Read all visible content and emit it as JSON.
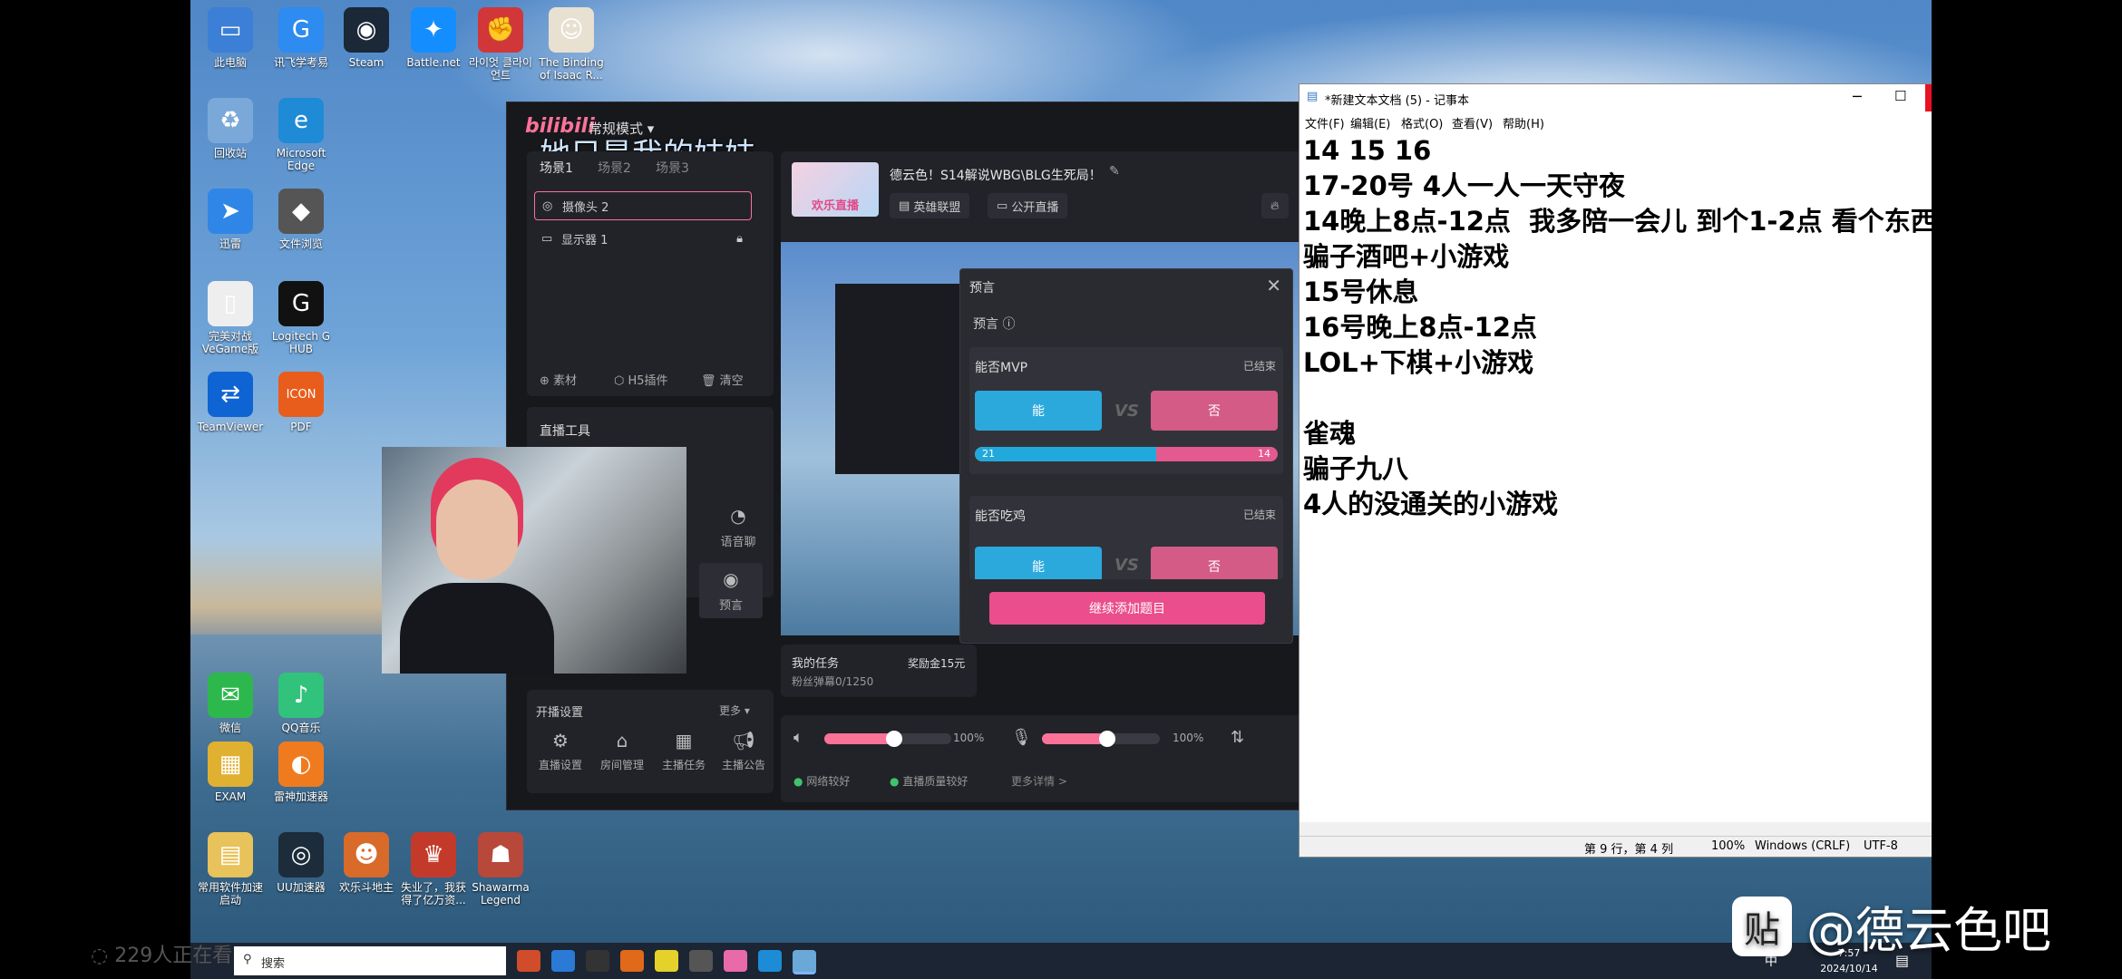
{
  "desktop_icons": [
    {
      "label": "此电脑",
      "color": "#3b7fd6",
      "glyph": "▭"
    },
    {
      "label": "讯飞学考易",
      "color": "#2e8bef",
      "glyph": "G"
    },
    {
      "label": "Steam",
      "color": "#1b2838",
      "glyph": "◉"
    },
    {
      "label": "Battle.net",
      "color": "#148eff",
      "glyph": "✦"
    },
    {
      "label": "라이엇 클라이언트",
      "color": "#d13639",
      "glyph": "✊"
    },
    {
      "label": "The Binding of Isaac R...",
      "color": "#e8e0d0",
      "glyph": "☺"
    },
    {
      "label": "回收站",
      "color": "#7aa9d9",
      "glyph": "♻"
    },
    {
      "label": "Microsoft Edge",
      "color": "#1f8ad6",
      "glyph": "e"
    },
    {
      "label": "迅雷",
      "color": "#2f86e6",
      "glyph": "➤"
    },
    {
      "label": "文件浏览",
      "color": "#555",
      "glyph": "◆"
    },
    {
      "label": "完美对战 VeGame版",
      "color": "#eee",
      "glyph": "▯"
    },
    {
      "label": "Logitech G HUB",
      "color": "#111",
      "glyph": "G"
    },
    {
      "label": "TeamViewer",
      "color": "#0e64d2",
      "glyph": "⇄"
    },
    {
      "label": "PDF",
      "color": "#e85d1c",
      "glyph": "ICON"
    },
    {
      "label": "微信",
      "color": "#2db84d",
      "glyph": "✉"
    },
    {
      "label": "QQ音乐",
      "color": "#31c27c",
      "glyph": "♪"
    },
    {
      "label": "EXAM",
      "color": "#e0b030",
      "glyph": "▦"
    },
    {
      "label": "雷神加速器",
      "color": "#f07b1e",
      "glyph": "◐"
    },
    {
      "label": "常用软件加速启动",
      "color": "#e8c25a",
      "glyph": "▤"
    },
    {
      "label": "UU加速器",
      "color": "#1c2c3a",
      "glyph": "◎"
    },
    {
      "label": "欢乐斗地主",
      "color": "#d86a2a",
      "glyph": "☻"
    },
    {
      "label": "失业了，我获得了亿万资...",
      "color": "#c43a2a",
      "glyph": "♛"
    },
    {
      "label": "Shawarma Legend",
      "color": "#b8483a",
      "glyph": "☗"
    }
  ],
  "app": {
    "logo": "bilibili",
    "mode": "常规模式 ▾",
    "overlay_title": "她只是我的妹妹",
    "scenes": [
      "场景1",
      "场景2",
      "场景3"
    ],
    "sources": [
      "摄像头 2",
      "显示器 1"
    ],
    "source_tools": [
      "素材",
      "H5插件",
      "清空"
    ],
    "tools_title": "直播工具",
    "tool_labels": [
      "语音聊",
      "预言"
    ],
    "settings_title": "开播设置",
    "more": "更多 ▾",
    "settings_items": [
      "直播设置",
      "房间管理",
      "主播任务",
      "主播公告"
    ],
    "stream_title": "德云色！S14解说WBG\\BLG生死局！",
    "stream_thumb_text": "欢乐直播",
    "category": "英雄联盟",
    "visibility": "公开直播",
    "task_title": "我的任务",
    "task_reward": "奖励金15元",
    "task_progress": "粉丝弹幕0/1250",
    "speaker_volume": "100%",
    "mic_volume": "100%",
    "speaker_level": 0.55,
    "mic_level": 0.55,
    "status_network": "网络较好",
    "status_quality": "直播质量较好",
    "status_more": "更多详情 >"
  },
  "prediction": {
    "dialog_title": "预言",
    "section_title": "预言 ⓘ",
    "cards": [
      {
        "question": "能否MVP",
        "status": "已结束",
        "yes": "能",
        "no": "否",
        "vs": "VS",
        "yes_count": "21",
        "no_count": "14",
        "yes_ratio": 0.6
      },
      {
        "question": "能否吃鸡",
        "status": "已结束",
        "yes": "能",
        "no": "否",
        "vs": "VS"
      }
    ],
    "add_button": "继续添加题目"
  },
  "notepad": {
    "title": "*新建文本文档 (5) - 记事本",
    "menu": [
      "文件(F)",
      "编辑(E)",
      "格式(O)",
      "查看(V)",
      "帮助(H)"
    ],
    "lines": [
      "14 15 16",
      "17-20号 4人一人一天守夜",
      "14晚上8点-12点  我多陪一会儿 到个1-2点 看个东西",
      "骗子酒吧+小游戏",
      "15号休息",
      "16号晚上8点-12点",
      "LOL+下棋+小游戏",
      "",
      "雀魂",
      "骗子九八",
      "4人的没通关的小游戏"
    ],
    "status": {
      "position": "第 9 行，第 4 列",
      "zoom": "100%",
      "line_ending": "Windows (CRLF)",
      "encoding": "UTF-8"
    }
  },
  "taskbar": {
    "search_placeholder": "搜索",
    "viewers": "229人正在看",
    "time": "7:57",
    "date": "2024/10/14",
    "ime": "中"
  },
  "watermark": {
    "badge": "贴",
    "text": "@德云色吧"
  }
}
